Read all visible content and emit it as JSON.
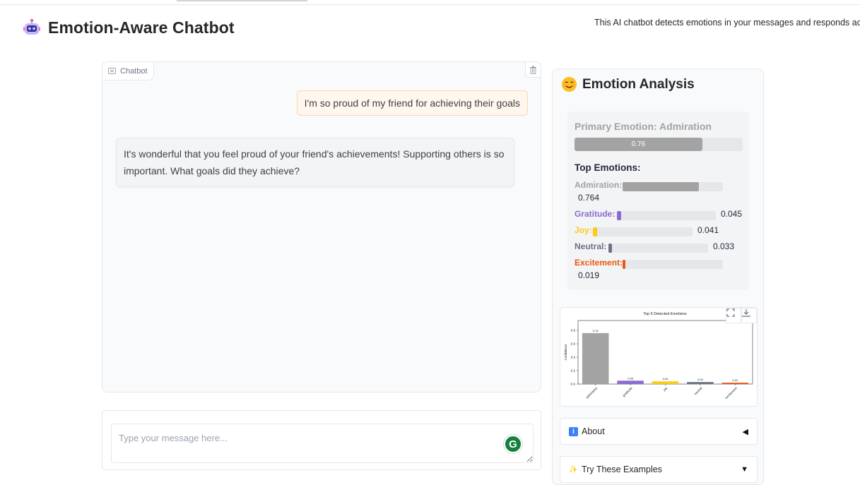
{
  "app": {
    "title": "Emotion-Aware Chatbot",
    "subtitle": "This AI chatbot detects emotions in your messages and responds accordingly."
  },
  "chat": {
    "label": "Chatbot",
    "messages": [
      {
        "role": "user",
        "text": "I'm so proud of my friend for achieving their goals"
      },
      {
        "role": "bot",
        "text": "It's wonderful that you feel proud of your friend's achievements! Supporting others is so important. What goals did they achieve?"
      }
    ],
    "input_placeholder": "Type your message here...",
    "grammarly_letter": "G"
  },
  "analysis": {
    "heading": "Emotion Analysis",
    "primary_label": "Primary Emotion: Admiration",
    "primary_value": 0.76,
    "primary_value_text": "0.76",
    "top_title": "Top Emotions:",
    "emotions": [
      {
        "name": "Admiration:",
        "value": 0.764,
        "value_text": "0.764",
        "color": "#a3a3a3"
      },
      {
        "name": "Gratitude:",
        "value": 0.045,
        "value_text": "0.045",
        "color": "#8b6bd1"
      },
      {
        "name": "Joy:",
        "value": 0.041,
        "value_text": "0.041",
        "color": "#facc15"
      },
      {
        "name": "Neutral:",
        "value": 0.033,
        "value_text": "0.033",
        "color": "#6b7280"
      },
      {
        "name": "Excitement:",
        "value": 0.019,
        "value_text": "0.019",
        "color": "#ea580c"
      }
    ]
  },
  "chart_data": {
    "type": "bar",
    "title": "Top 5 Detected Emotions",
    "xlabel": "",
    "ylabel": "Confidence",
    "categories": [
      "admiration",
      "gratitude",
      "joy",
      "neutral",
      "excitement"
    ],
    "values": [
      0.76,
      0.05,
      0.04,
      0.03,
      0.02
    ],
    "value_labels": [
      "0.76",
      "0.05",
      "0.04",
      "0.03",
      "0.02"
    ],
    "colors": [
      "#a3a3a3",
      "#8b6bd1",
      "#facc15",
      "#6b7280",
      "#ea580c"
    ],
    "yticks": [
      "0.0",
      "0.2",
      "0.4",
      "0.6",
      "0.8"
    ],
    "ylim": [
      0,
      0.8
    ],
    "grid": false
  },
  "accordions": [
    {
      "icon": "info-icon",
      "label": "About",
      "state": "collapsed"
    },
    {
      "icon": "sparkles-icon",
      "label": "Try These Examples",
      "state": "collapsed"
    }
  ]
}
